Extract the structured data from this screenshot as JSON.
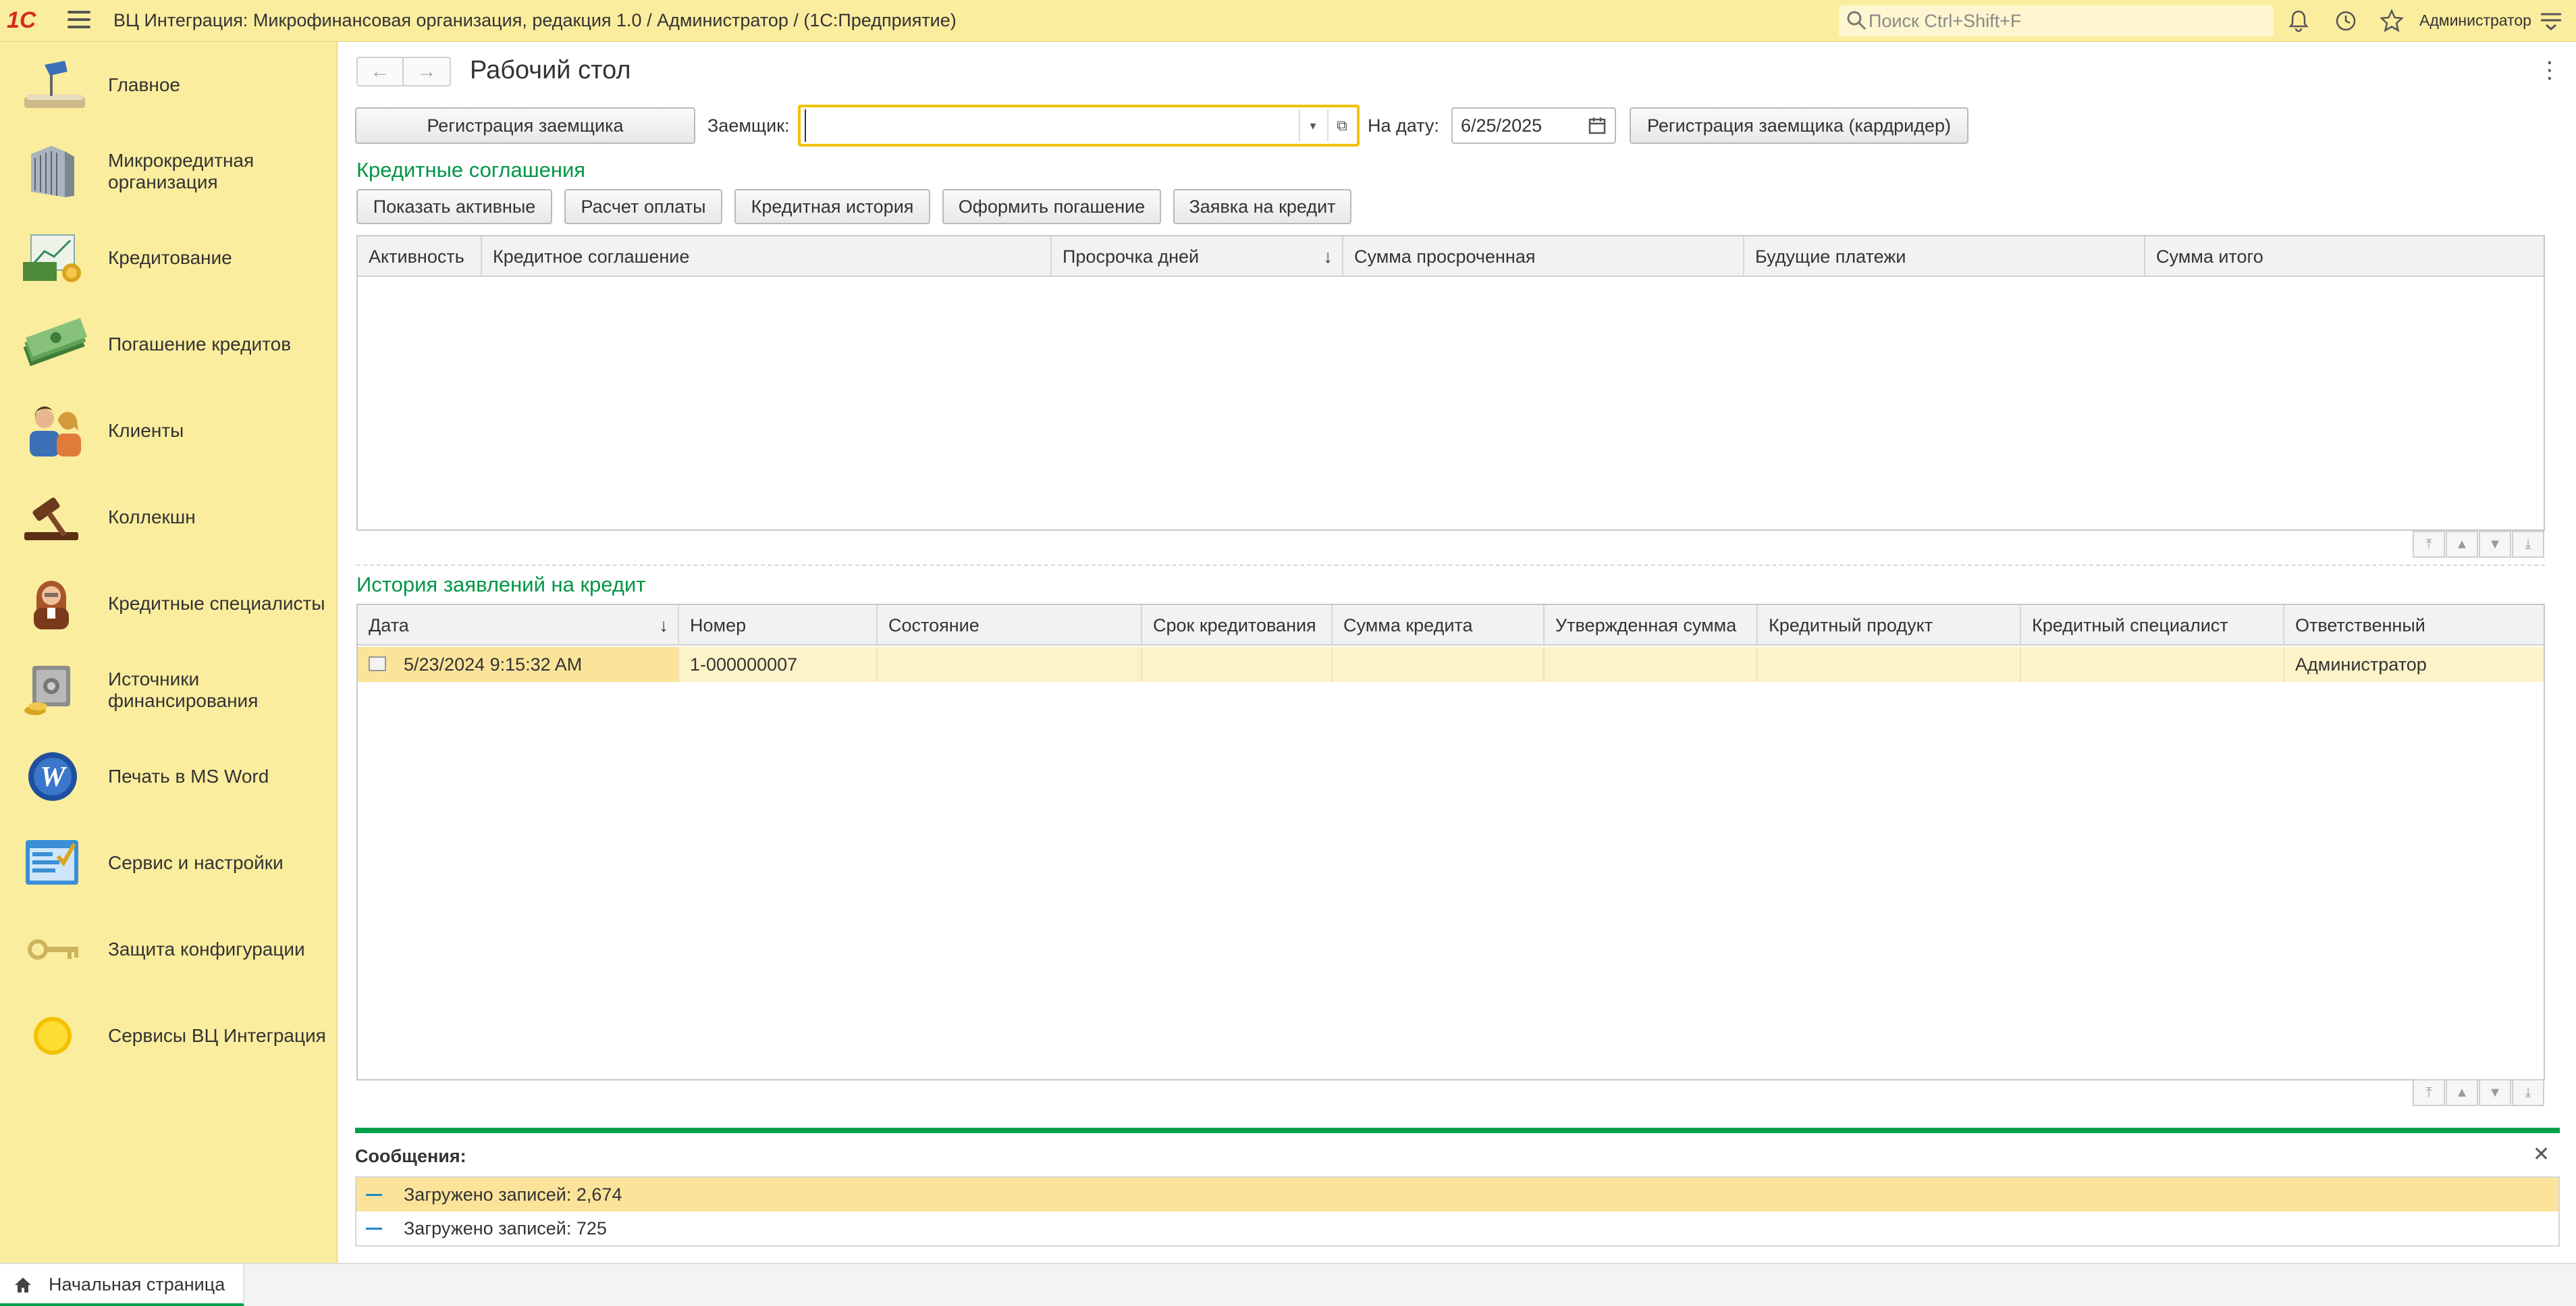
{
  "app": {
    "logo": "1С",
    "title": "ВЦ Интеграция: Микрофинансовая организация, редакция 1.0 / Администратор /  (1С:Предприятие)",
    "search_placeholder": "Поиск Ctrl+Shift+F",
    "user": "Администратор"
  },
  "sidebar": {
    "items": [
      {
        "label": "Главное",
        "icon": "lamp-icon"
      },
      {
        "label": "Микрокредитная организация",
        "icon": "building-icon"
      },
      {
        "label": "Кредитование",
        "icon": "money-chart-icon"
      },
      {
        "label": "Погашение кредитов",
        "icon": "banknotes-icon"
      },
      {
        "label": "Клиенты",
        "icon": "clients-icon"
      },
      {
        "label": "Коллекшн",
        "icon": "gavel-icon"
      },
      {
        "label": "Кредитные специалисты",
        "icon": "specialist-icon"
      },
      {
        "label": "Источники финансирования",
        "icon": "safe-coins-icon"
      },
      {
        "label": "Печать в MS Word",
        "icon": "word-icon"
      },
      {
        "label": "Сервис и настройки",
        "icon": "settings-window-icon"
      },
      {
        "label": "Защита конфигурации",
        "icon": "keys-icon"
      },
      {
        "label": "Сервисы ВЦ Интеграция",
        "icon": "sun-icon"
      }
    ]
  },
  "page": {
    "title": "Рабочий стол",
    "register_button": "Регистрация заемщика",
    "borrower_label": "Заемщик:",
    "borrower_value": "",
    "date_label": "На дату:",
    "date_value": "6/25/2025",
    "register_card_button": "Регистрация заемщика (кардридер)"
  },
  "agreements": {
    "title": "Кредитные соглашения",
    "buttons": [
      "Показать активные",
      "Расчет оплаты",
      "Кредитная история",
      "Оформить погашение",
      "Заявка на кредит"
    ],
    "columns": [
      "Активность",
      "Кредитное соглашение",
      "Просрочка дней",
      "Сумма просроченная",
      "Будущие платежи",
      "Сумма итого"
    ],
    "sort_indicator": "↓",
    "rows": []
  },
  "history": {
    "title": "История заявлений на кредит",
    "columns": [
      "Дата",
      "Номер",
      "Состояние",
      "Срок кредитования",
      "Сумма кредита",
      "Утвержденная сумма",
      "Кредитный продукт",
      "Кредитный специалист",
      "Ответственный"
    ],
    "sort_indicator": "↓",
    "rows": [
      {
        "date": "5/23/2024 9:15:32 AM",
        "number": "1-000000007",
        "state": "",
        "term": "",
        "amount": "",
        "approved": "",
        "product": "",
        "specialist": "",
        "responsible": "Администратор"
      }
    ]
  },
  "messages": {
    "title": "Сообщения:",
    "items": [
      "Загружено записей: 2,674",
      "Загружено записей: 725"
    ]
  },
  "footer": {
    "tab": "Начальная страница"
  },
  "colors": {
    "panel": "#fbed9e",
    "accent_green": "#009646",
    "highlight": "#fce9a3"
  }
}
